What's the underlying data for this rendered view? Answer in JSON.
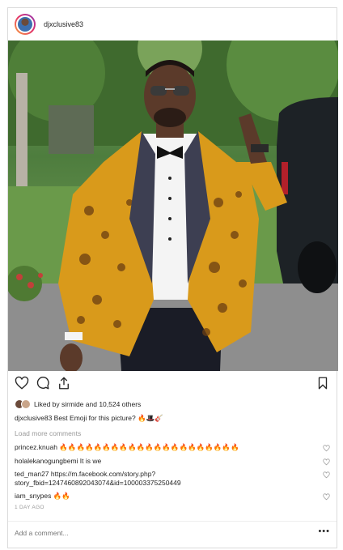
{
  "post": {
    "username": "djxclusive83",
    "likes_text": "Liked by sirmide and 10,524 others",
    "caption": "djxclusive83 Best Emoji for this picture? 🔥🎩🎸",
    "load_more": "Load more comments",
    "comments": [
      {
        "text": "princez.knuah 🔥🔥🔥🔥🔥🔥🔥🔥🔥🔥🔥🔥🔥🔥🔥🔥🔥🔥🔥🔥🔥"
      },
      {
        "text": "holalekanogungbemi It is we"
      },
      {
        "text": "ted_man27 https://m.facebook.com/story.php?",
        "text2": "story_fbid=1247460892043074&id=100003375250449"
      },
      {
        "text": "iam_snypes 🔥🔥"
      }
    ],
    "time": "1 DAY AGO",
    "add_comment_placeholder": "Add a comment...",
    "more_icon": "•••"
  },
  "colors": {
    "jacket": "#d99a1b",
    "lapel": "#3d3f52",
    "border": "#dbdbdb",
    "muted": "#999999"
  }
}
